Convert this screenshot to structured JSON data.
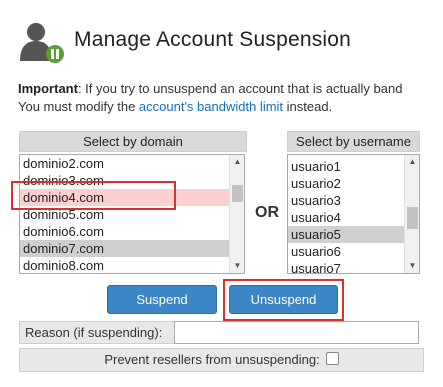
{
  "header": {
    "title": "Manage Account Suspension",
    "icon": "user-suspend-icon"
  },
  "notice": {
    "bold": "Important",
    "line1_rest": ": If you try to unsuspend an account that is actually band",
    "line2_before": "You must modify the ",
    "link": "account's bandwidth limit",
    "line2_after": " instead."
  },
  "domain_panel": {
    "header": "Select by domain",
    "items": [
      "dominio2.com",
      "dominio3.com",
      "dominio4.com",
      "dominio5.com",
      "dominio6.com",
      "dominio7.com",
      "dominio8.com"
    ],
    "selected": "dominio7.com",
    "highlighted": "dominio4.com"
  },
  "or_label": "OR",
  "user_panel": {
    "header": "Select by username",
    "items": [
      "usuario1",
      "usuario2",
      "usuario3",
      "usuario4",
      "usuario5",
      "usuario6",
      "usuario7"
    ],
    "selected": "usuario5"
  },
  "buttons": {
    "suspend": "Suspend",
    "unsuspend": "Unsuspend"
  },
  "reason": {
    "label": "Reason (if suspending):",
    "value": ""
  },
  "prevent": {
    "label": "Prevent resellers from unsuspending:",
    "checked": false
  },
  "colors": {
    "button": "#3d86c6",
    "highlight_box": "#d9312f",
    "link": "#1a6eb8"
  }
}
